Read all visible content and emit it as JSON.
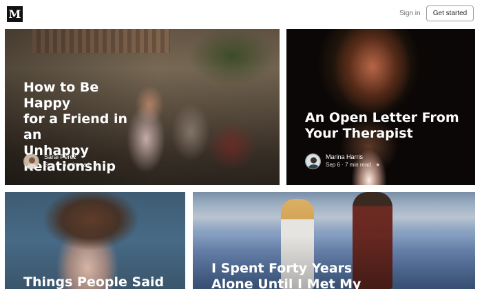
{
  "header": {
    "logo_letter": "M",
    "signin_label": "Sign in",
    "get_started_label": "Get started"
  },
  "cards": [
    {
      "title": "How to Be Happy\nfor a Friend in an\nUnhappy\nRelationship",
      "author": "Sarai Perez",
      "date": "Sep 6",
      "read_time": "6 min read"
    },
    {
      "title": "An Open Letter From\nYour Therapist",
      "author": "Marina Harris",
      "date": "Sep 6",
      "read_time": "7 min read"
    },
    {
      "title": "Things People Said"
    },
    {
      "title": "I Spent Forty Years\nAlone Until I Met My"
    }
  ],
  "icons": {
    "star": "★",
    "separator": "·"
  },
  "colors": {
    "text_light": "#ffffff",
    "header_text": "#6b6b6b",
    "button_border": "#9b9b9b"
  }
}
